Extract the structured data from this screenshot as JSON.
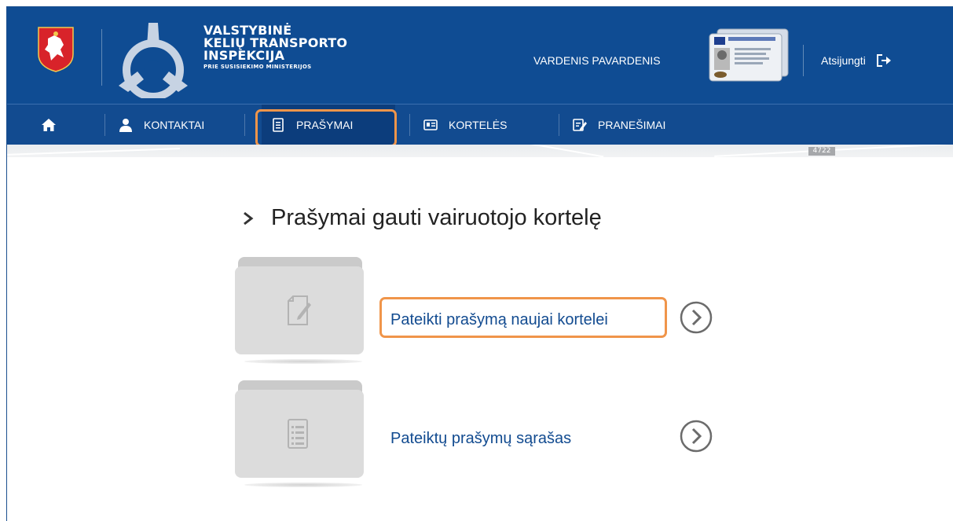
{
  "header": {
    "brand_lines": [
      "VALSTYBINĖ",
      "KELIŲ TRANSPORTO",
      "INSPEKCIJA"
    ],
    "brand_sub": "PRIE SUSISIEKIMO MINISTERIJOS",
    "user_name": "VARDENIS PAVARDENIS",
    "logout_label": "Atsijungti"
  },
  "nav": {
    "items": [
      {
        "label": "KONTAKTAI",
        "icon": "person-icon"
      },
      {
        "label": "PRAŠYMAI",
        "icon": "document-icon"
      },
      {
        "label": "KORTELĖS",
        "icon": "id-card-icon"
      },
      {
        "label": "PRANEŠIMAI",
        "icon": "edit-note-icon"
      }
    ],
    "home_icon": "home-icon",
    "active": "PRAŠYMAI"
  },
  "map_tag": "4722",
  "content": {
    "title": "Prašymai gauti vairuotojo kortelę",
    "actions": [
      {
        "label": "Pateikti prašymą naujai kortelei",
        "icon": "edit-document-icon"
      },
      {
        "label": "Pateiktų prašymų sąrašas",
        "icon": "list-document-icon"
      }
    ]
  },
  "colors": {
    "header_blue": "#0f4c93",
    "nav_blue": "#124b90",
    "highlight_orange": "#f0954a",
    "link_blue": "#124b90"
  }
}
